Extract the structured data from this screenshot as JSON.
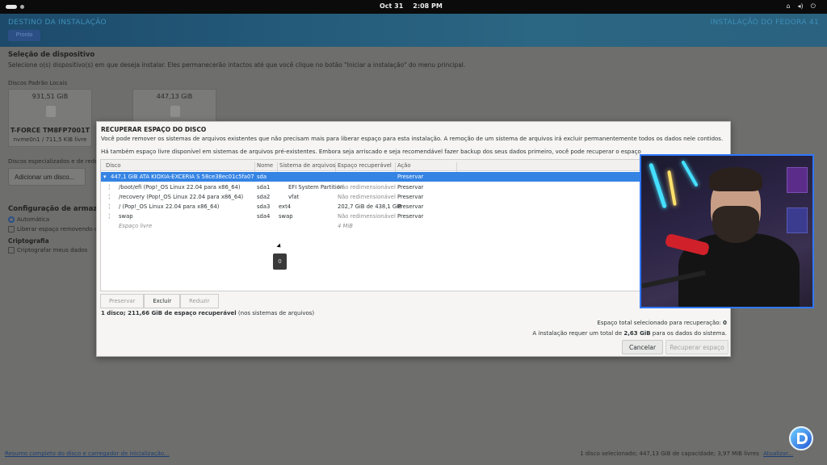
{
  "topbar": {
    "date": "Oct 31",
    "time": "2:08 PM"
  },
  "installer": {
    "header_left": "DESTINO DA INSTALAÇÃO",
    "header_right": "INSTALAÇÃO DO FEDORA 41",
    "done_button": "Pronto",
    "section_title": "Seleção de dispositivo",
    "section_desc": "Selecione o(s) dispositivo(s) em que deseja instalar. Eles permanecerão intactos até que você clique no botão \"Iniciar a instalação\" do menu principal.",
    "local_disks_label": "Discos Padrão Locais",
    "disks": [
      {
        "capacity": "931,51 GiB",
        "name": "T-FORCE TM8FP7001T",
        "sub": "nvme0n1  /  711,5 KiB livre"
      },
      {
        "capacity": "447,13 GiB",
        "name": "",
        "sub": ""
      }
    ],
    "specialized_label": "Discos especializados e de rede",
    "add_disk_button": "Adicionar um disco...",
    "storage_config_title": "Configuração de armazenamento",
    "auto_option": "Automática",
    "free_space_option": "Liberar espaço removendo ou",
    "crypto_title": "Criptografia",
    "crypto_option": "Criptografar meus dados",
    "summary_link": "Resumo completo do disco e carregador de inicialização...",
    "status_right": "1 disco selecionado; 447,13 GiB de capacidade; 3,97 MiB livres",
    "refresh_link": "Atualizar..."
  },
  "dialog": {
    "title": "RECUPERAR ESPAÇO DO DISCO",
    "para1": "Você pode remover os sistemas de arquivos existentes que não precisam mais para liberar espaço para esta instalação. A remoção de um sistema de arquivos irá excluir permanentemente todos os dados nele contidos.",
    "para2": "Há também espaço livre disponível em sistemas de arquivos pré-existentes.  Embora seja arriscado e seja recomendável fazer backup dos seus dados primeiro, você pode recuperar o espaço livre em disco e disponibilizá-lo para a instalação abaixo.",
    "columns": {
      "disk": "Disco",
      "name": "Nome",
      "fs": "Sistema de arquivos",
      "reclaimable": "Espaço recuperável",
      "action": "Ação"
    },
    "rows": [
      {
        "disk": "447,1 GiB ATA KIOXIA-EXCERIA S 58ce38ec01c5fa07",
        "name": "sda",
        "fs": "",
        "reclaimable": "",
        "action": "Preservar"
      },
      {
        "disk": "/boot/efi (Pop!_OS Linux 22.04 para x86_64)",
        "name": "sda1",
        "fs": "EFI System Partition",
        "reclaimable": "Não redimensionável",
        "action": "Preservar"
      },
      {
        "disk": "/recovery (Pop!_OS Linux 22.04 para x86_64)",
        "name": "sda2",
        "fs": "vfat",
        "reclaimable": "Não redimensionável",
        "action": "Preservar"
      },
      {
        "disk": "/ (Pop!_OS Linux 22.04 para x86_64)",
        "name": "sda3",
        "fs": "ext4",
        "reclaimable": "202,7 GiB de 438,1 GiB",
        "action": "Preservar"
      },
      {
        "disk": "swap",
        "name": "sda4",
        "fs": "swap",
        "reclaimable": "Não redimensionável",
        "action": "Preservar"
      },
      {
        "disk": "Espaço livre",
        "name": "",
        "fs": "",
        "reclaimable": "4 MiB",
        "action": ""
      }
    ],
    "tooltip": "0",
    "buttons": {
      "preserve": "Preservar",
      "delete": "Excluir",
      "shrink": "Reduzir"
    },
    "summary_bold": "1 disco; 211,66 GiB de espaço recuperável",
    "summary_rest": " (nos sistemas de arquivos)",
    "total_label": "Espaço total selecionado para recuperação: ",
    "total_value": "0",
    "req_prefix": "A instalação requer um total de ",
    "req_value": "2,63 GiB",
    "req_suffix": " para os dados do sistema.",
    "cancel": "Cancelar",
    "recover": "Recuperar espaço"
  },
  "colors": {
    "accent": "#3584e4",
    "webcam_border": "#2f78ff"
  }
}
